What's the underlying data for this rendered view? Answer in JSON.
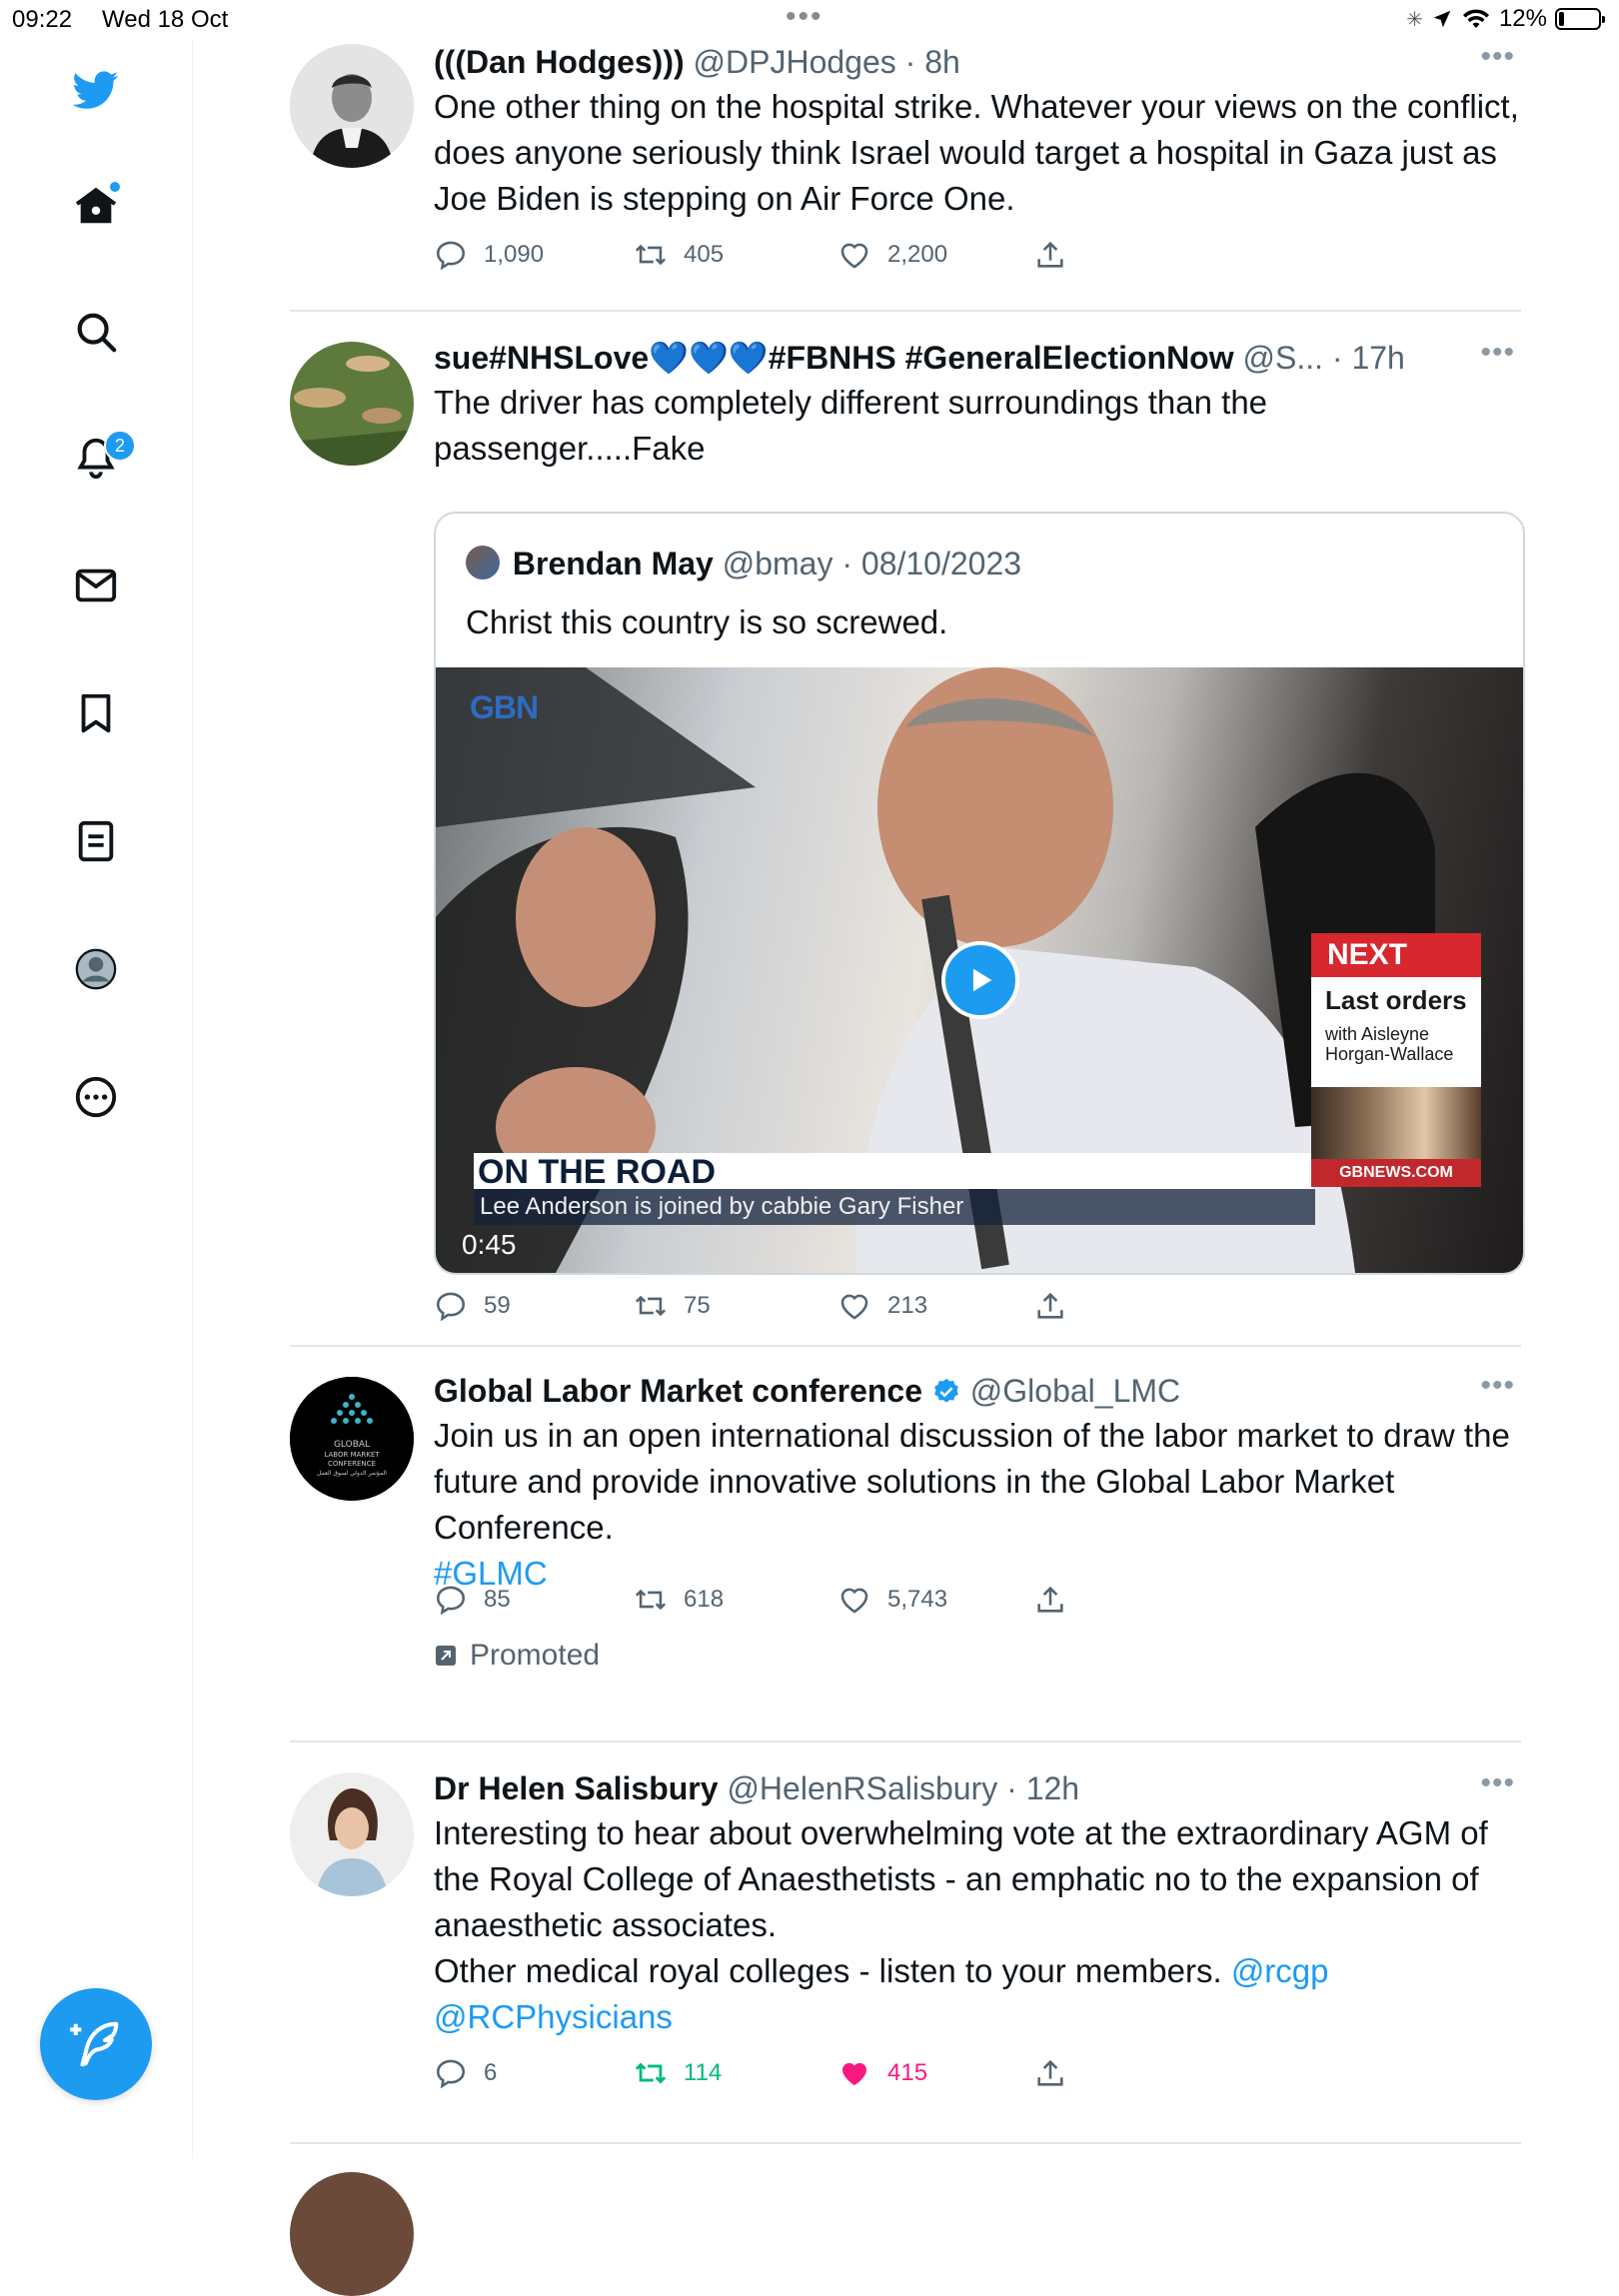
{
  "status_bar": {
    "time": "09:22",
    "date": "Wed 18 Oct",
    "battery": "12%",
    "battery_level": 0.12
  },
  "sidebar": {
    "items": [
      {
        "icon": "bird-logo-icon",
        "label": "Twitter"
      },
      {
        "icon": "home-icon",
        "label": "Home"
      },
      {
        "icon": "search-icon",
        "label": "Explore"
      },
      {
        "icon": "bell-icon",
        "label": "Notifications",
        "badge": "2"
      },
      {
        "icon": "mail-icon",
        "label": "Messages"
      },
      {
        "icon": "bookmark-icon",
        "label": "Bookmarks"
      },
      {
        "icon": "list-icon",
        "label": "Lists"
      },
      {
        "icon": "profile-icon",
        "label": "Profile"
      },
      {
        "icon": "more-circle-icon",
        "label": "More"
      }
    ],
    "compose_icon": "compose-feather-icon"
  },
  "colors": {
    "accent": "#1d9bf0",
    "retweet_active": "#00ba7c",
    "like_active": "#f91880",
    "text": "#0f1419",
    "secondary": "#536471"
  },
  "tweets": [
    {
      "name": "(((Dan Hodges)))",
      "handle": "@DPJHodges",
      "time": "8h",
      "text": "One other thing on the hospital strike. Whatever your views on the conflict, does anyone seriously think Israel would target a hospital in Gaza just as Joe Biden is stepping on Air Force One.",
      "replies": "1,090",
      "retweets": "405",
      "likes": "2,200"
    },
    {
      "name": "sue#NHSLove💙💙💙#FBNHS #GeneralElectionNow",
      "handle": "@S...",
      "time": "17h",
      "text": "The driver has completely different surroundings than the passenger.....Fake",
      "quote": {
        "name": "Brendan May",
        "handle": "@bmay",
        "date": "08/10/2023",
        "text": "Christ this country is so screwed.",
        "video": {
          "channel_logo": "GBN",
          "lower_title": "ON THE ROAD",
          "lower_subtitle": "Lee Anderson is joined by cabbie Gary Fisher",
          "duration": "0:45",
          "next_label": "NEXT",
          "next_title": "Last orders",
          "next_with": "with Aisleyne Horgan-Wallace",
          "next_url": "GBNEWS.COM"
        }
      },
      "replies": "59",
      "retweets": "75",
      "likes": "213"
    },
    {
      "name": "Global Labor Market conference",
      "verified": true,
      "handle": "@Global_LMC",
      "text": "Join us in an open international discussion of the labor market to draw the future and provide innovative solutions in the Global Labor Market Conference.",
      "hashtag": "#GLMC",
      "replies": "85",
      "retweets": "618",
      "likes": "5,743",
      "promoted_label": "Promoted",
      "logo_text": [
        "GLOBAL",
        "LABOR MARKET",
        "CONFERENCE",
        "المؤتمر الدولي لسوق العمل"
      ]
    },
    {
      "name": "Dr Helen Salisbury",
      "handle": "@HelenRSalisbury",
      "time": "12h",
      "text": "Interesting to hear about overwhelming vote at the extraordinary AGM of the Royal College of Anaesthetists - an emphatic no to the expansion of anaesthetic associates.",
      "text2": "Other medical royal colleges - listen to your members.",
      "mention1": "@rcgp",
      "mention2": "@RCPhysicians",
      "replies": "6",
      "retweets": "114",
      "likes": "415"
    }
  ]
}
